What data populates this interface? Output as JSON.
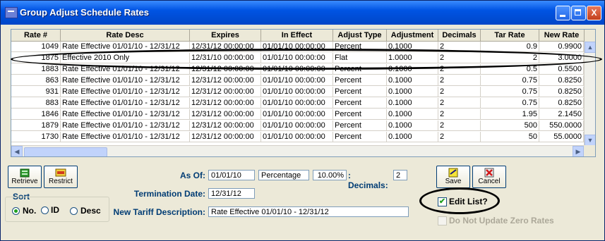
{
  "window": {
    "title": "Group Adjust Schedule Rates",
    "controls": {
      "minimize": "_",
      "maximize": "□",
      "close": "X"
    }
  },
  "grid": {
    "columns": [
      "Rate #",
      "Rate Desc",
      "Expires",
      "In Effect",
      "Adjust Type",
      "Adjustment",
      "Decimals",
      "Tar Rate",
      "New Rate"
    ],
    "rows": [
      [
        "1049",
        "Rate Effective 01/01/10 - 12/31/12",
        "12/31/12 00:00:00",
        "01/01/10 00:00:00",
        "Percent",
        "0.1000",
        "2",
        "0.9",
        "0.9900"
      ],
      [
        "1875",
        "Effective 2010  Only",
        "12/31/10 00:00:00",
        "01/01/10 00:00:00",
        "Flat",
        "1.0000",
        "2",
        "2",
        "3.0000"
      ],
      [
        "1883",
        "Rate Effective 01/01/10 - 12/31/12",
        "12/31/12 00:00:00",
        "01/01/10 00:00:00",
        "Percent",
        "0.1000",
        "2",
        "0.5",
        "0.5500"
      ],
      [
        "863",
        "Rate Effective 01/01/10 - 12/31/12",
        "12/31/12 00:00:00",
        "01/01/10 00:00:00",
        "Percent",
        "0.1000",
        "2",
        "0.75",
        "0.8250"
      ],
      [
        "931",
        "Rate Effective 01/01/10 - 12/31/12",
        "12/31/12 00:00:00",
        "01/01/10 00:00:00",
        "Percent",
        "0.1000",
        "2",
        "0.75",
        "0.8250"
      ],
      [
        "883",
        "Rate Effective 01/01/10 - 12/31/12",
        "12/31/12 00:00:00",
        "01/01/10 00:00:00",
        "Percent",
        "0.1000",
        "2",
        "0.75",
        "0.8250"
      ],
      [
        "1846",
        "Rate Effective 01/01/10 - 12/31/12",
        "12/31/12 00:00:00",
        "01/01/10 00:00:00",
        "Percent",
        "0.1000",
        "2",
        "1.95",
        "2.1450"
      ],
      [
        "1879",
        "Rate Effective 01/01/10 - 12/31/12",
        "12/31/12 00:00:00",
        "01/01/10 00:00:00",
        "Percent",
        "0.1000",
        "2",
        "500",
        "550.0000"
      ],
      [
        "1730",
        "Rate Effective 01/01/10 - 12/31/12",
        "12/31/12 00:00:00",
        "01/01/10 00:00:00",
        "Percent",
        "0.1000",
        "2",
        "50",
        "55.0000"
      ]
    ]
  },
  "toolbar": {
    "retrieve_label": "Retrieve",
    "restrict_label": "Restrict",
    "save_label": "Save",
    "cancel_label": "Cancel"
  },
  "sort": {
    "title": "Sort",
    "options": [
      "No.",
      "ID",
      "Desc"
    ],
    "selected": "No."
  },
  "form": {
    "as_of_label": "As Of:",
    "as_of_value": "01/01/10",
    "type_value": "Percentage",
    "percent_value": "10.00%",
    "decimals_label": ": Decimals:",
    "decimals_value": "2",
    "termination_label": "Termination Date:",
    "termination_value": "12/31/12",
    "tariff_label": "New Tariff Description:",
    "tariff_value": "Rate Effective 01/01/10 - 12/31/12"
  },
  "options": {
    "edit_list_label": "Edit List?",
    "edit_list_checked": true,
    "no_update_zero_label": "Do Not Update Zero Rates",
    "no_update_zero_checked": false
  },
  "icons": {
    "retrieve": "retrieve-icon",
    "restrict": "restrict-icon",
    "save": "save-icon",
    "cancel": "cancel-icon"
  },
  "colors": {
    "titlebar": "#0054e3",
    "accent_label": "#003c74",
    "annotation": "#000000"
  }
}
